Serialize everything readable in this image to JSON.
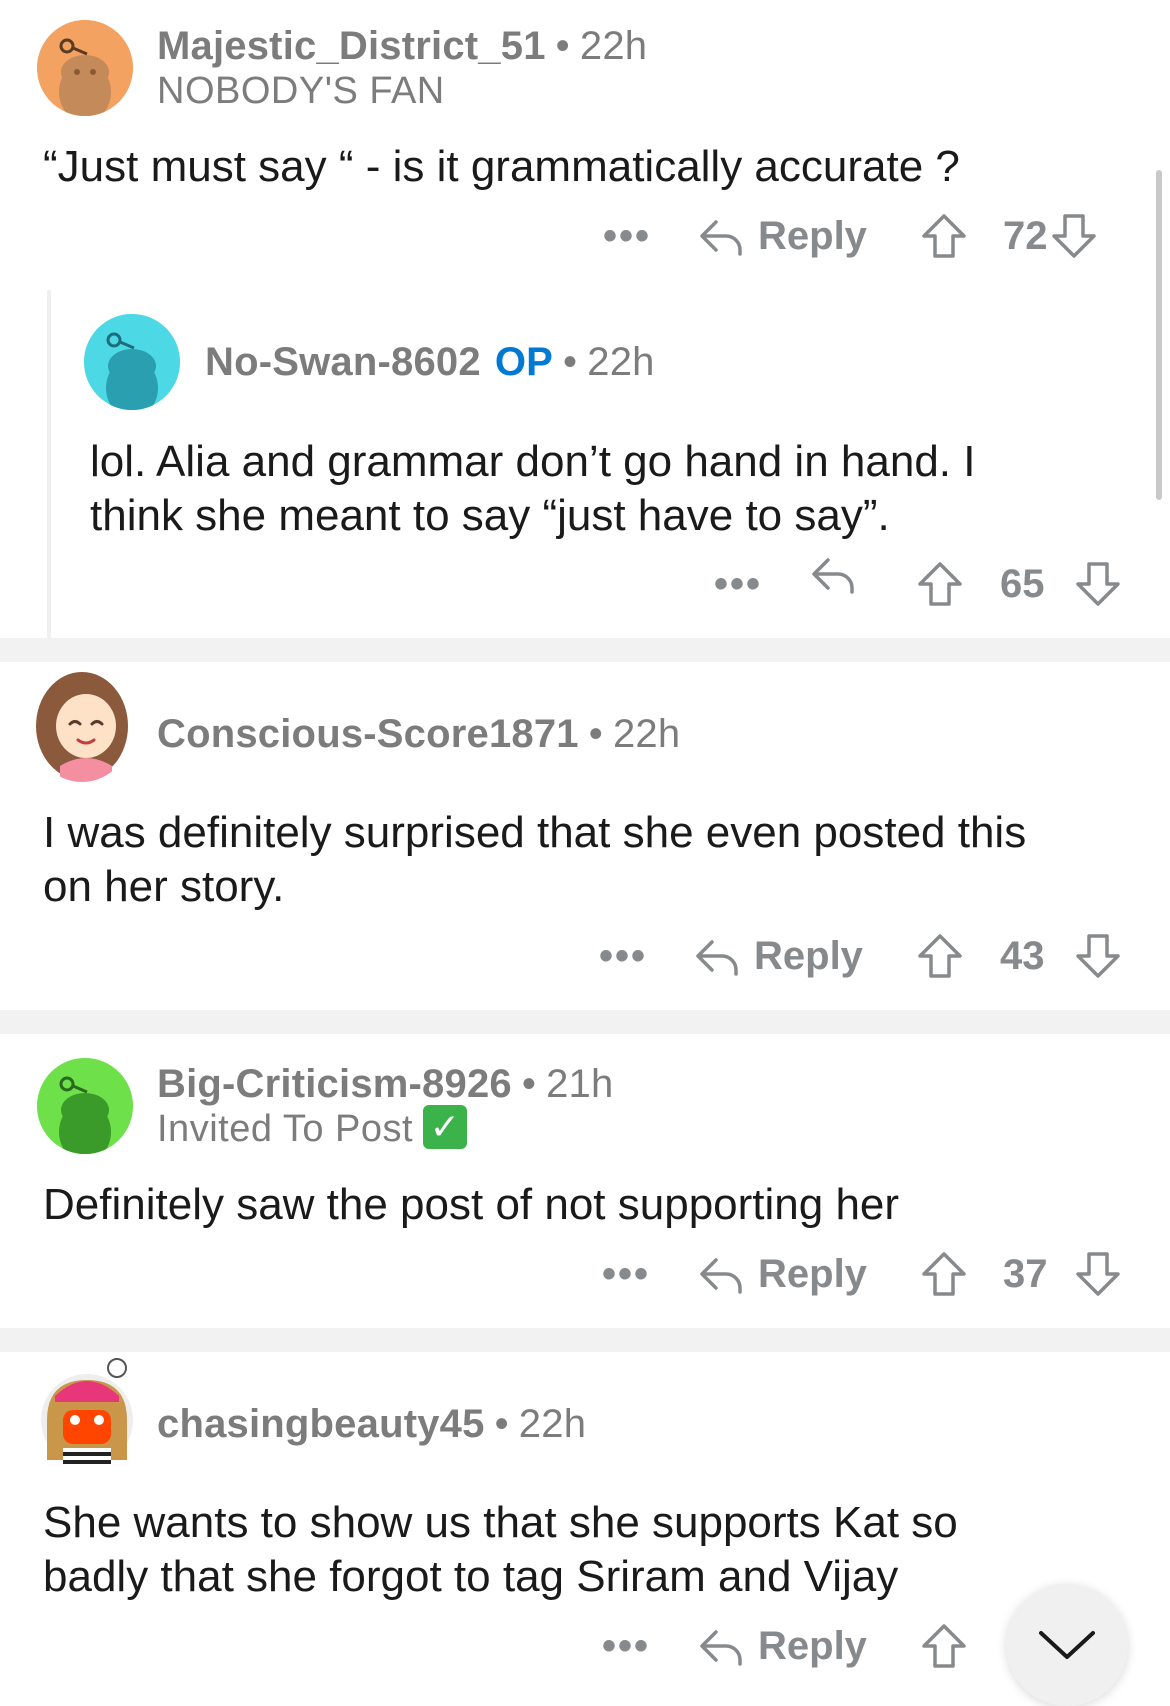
{
  "comments": [
    {
      "username": "Majestic_District_51",
      "time": "22h",
      "flair": "NOBODY'S FAN",
      "text": [
        "“Just must say “ - is it grammatically accurate ?"
      ],
      "reply_label": "Reply",
      "score": "72",
      "avatar_color": "#f4a261"
    },
    {
      "username": "No-Swan-8602",
      "op_badge": "OP",
      "time": "22h",
      "text": [
        "lol. Alia and grammar don’t go hand in hand. I",
        "think she meant to say “just have to say”."
      ],
      "score": "65",
      "avatar_color": "#4dd8e6"
    },
    {
      "username": "Conscious-Score1871",
      "time": "22h",
      "text": [
        "I was definitely surprised that she even posted this",
        "on her story."
      ],
      "reply_label": "Reply",
      "score": "43"
    },
    {
      "username": "Big-Criticism-8926",
      "time": "21h",
      "flair": "Invited To Post",
      "text": [
        "Definitely saw the post of not supporting her"
      ],
      "reply_label": "Reply",
      "score": "37",
      "avatar_color": "#6ee04a"
    },
    {
      "username": "chasingbeauty45",
      "time": "22h",
      "text": [
        "She wants to show us that she supports Kat so",
        "badly that she forgot to tag Sriram and Vijay"
      ],
      "reply_label": "Reply"
    }
  ],
  "ui": {
    "more": "•••",
    "separator": "•",
    "accent": "#0079d3",
    "muted": "#878a8c"
  },
  "icons": [
    "snoo-avatar-icon",
    "reply-arrow-icon",
    "upvote-arrow-icon",
    "downvote-arrow-icon",
    "more-dots-icon",
    "checkmark-icon",
    "chevron-down-icon"
  ]
}
